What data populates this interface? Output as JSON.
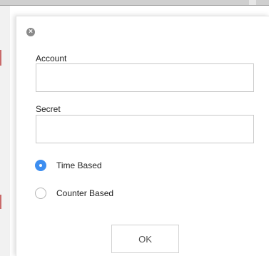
{
  "dialog": {
    "close_icon": "close-circle-icon",
    "close_glyph": "×",
    "account": {
      "label": "Account",
      "value": "",
      "placeholder": ""
    },
    "secret": {
      "label": "Secret",
      "value": "",
      "placeholder": ""
    },
    "radio_options": [
      {
        "label": "Time Based",
        "checked": true
      },
      {
        "label": "Counter Based",
        "checked": false
      }
    ],
    "ok_label": "OK"
  },
  "colors": {
    "accent": "#3d8ef0",
    "border": "#c8c8c8",
    "text": "#222222"
  }
}
